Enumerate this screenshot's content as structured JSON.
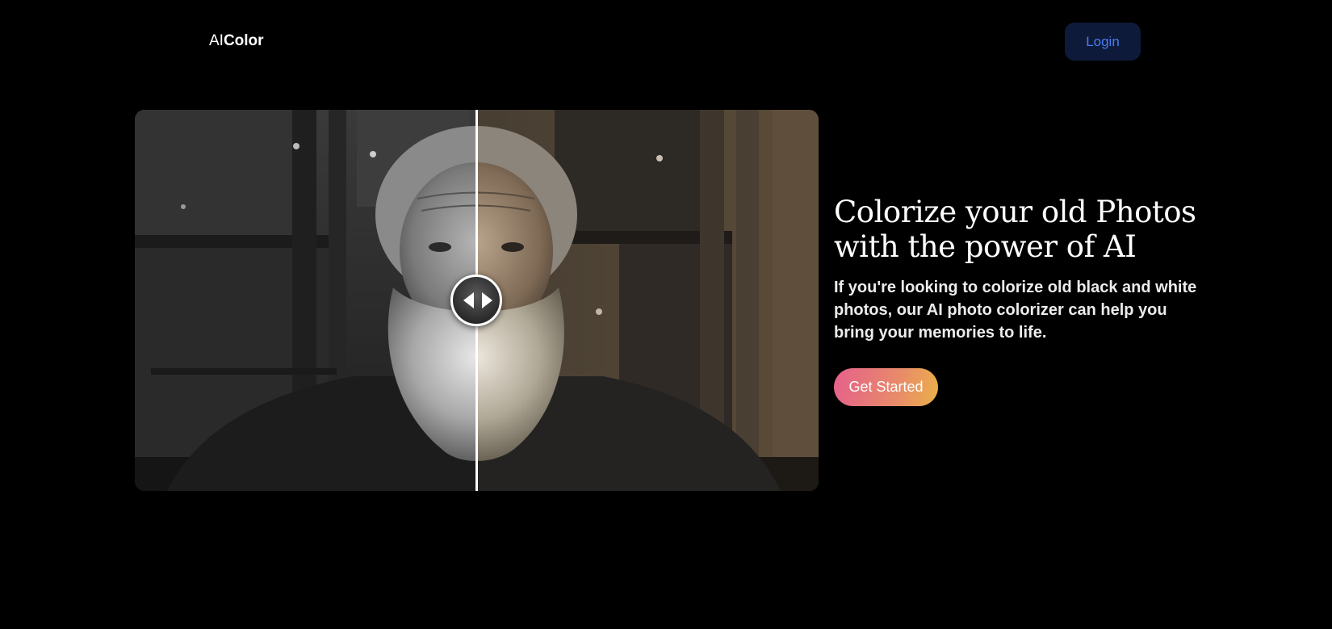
{
  "header": {
    "logo_light": "AI",
    "logo_bold": "Color",
    "login_label": "Login"
  },
  "compare": {
    "left_image": "black-and-white portrait of an old bearded man",
    "right_image": "colorized portrait of the same old bearded man",
    "slider_position": 0.5
  },
  "hero": {
    "title": "Colorize your old Photos with the power of AI",
    "subtitle": "If you're looking to colorize old black and white photos, our AI photo colorizer can help you bring your memories to life.",
    "cta_label": "Get Started"
  },
  "colors": {
    "background": "#000000",
    "login_bg": "#0e1a3a",
    "login_text": "#4a7cf0",
    "cta_gradient_start": "#e5608c",
    "cta_gradient_end": "#ebb04a"
  }
}
